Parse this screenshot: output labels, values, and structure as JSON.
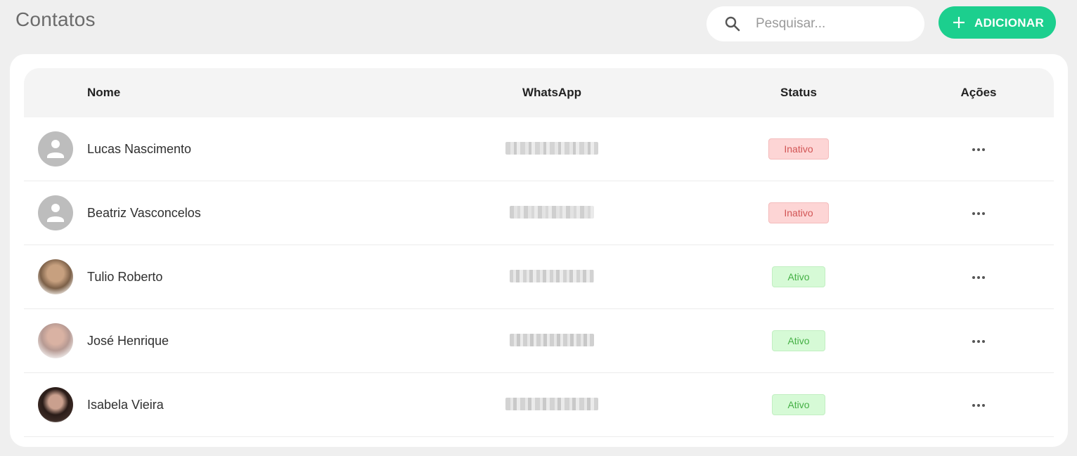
{
  "header": {
    "title": "Contatos",
    "search_placeholder": "Pesquisar...",
    "search_value": "",
    "add_label": "ADICIONAR",
    "accent_color": "#1ccf8e"
  },
  "table": {
    "columns": [
      "Nome",
      "WhatsApp",
      "Status",
      "Ações"
    ],
    "rows": [
      {
        "name": "Lucas Nascimento",
        "whatsapp": "",
        "status": "Inativo",
        "avatar": "default-user-icon"
      },
      {
        "name": "Beatriz Vasconcelos",
        "whatsapp": "",
        "status": "Inativo",
        "avatar": "default-user-icon"
      },
      {
        "name": "Tulio Roberto",
        "whatsapp": "",
        "status": "Ativo",
        "avatar": "photo"
      },
      {
        "name": "José Henrique",
        "whatsapp": "",
        "status": "Ativo",
        "avatar": "photo"
      },
      {
        "name": "Isabela Vieira",
        "whatsapp": "",
        "status": "Ativo",
        "avatar": "photo"
      }
    ],
    "row_action_icon": "more-horizontal-icon"
  },
  "status_colors": {
    "inativo_bg": "#fdd5d5",
    "inativo_text": "#d25555",
    "ativo_bg": "#d6fad6",
    "ativo_text": "#45b045"
  }
}
